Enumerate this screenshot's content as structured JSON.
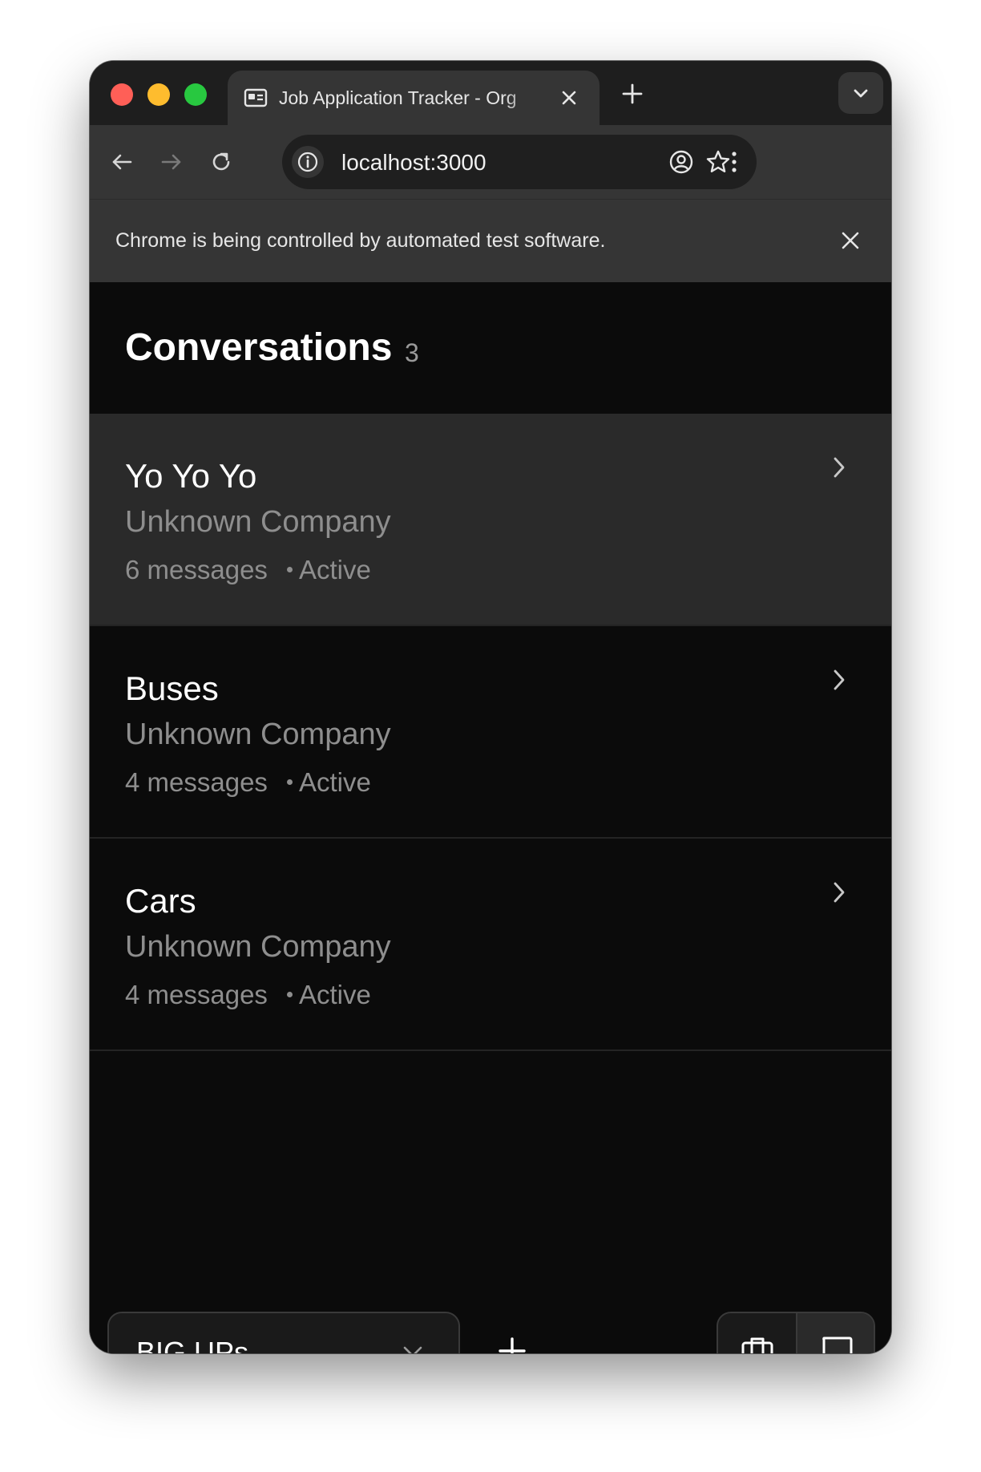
{
  "browser": {
    "tab_title": "Job Application Tracker - Org",
    "url": "localhost:3000",
    "automation_notice": "Chrome is being controlled by automated test software."
  },
  "header": {
    "title": "Conversations",
    "count": "3"
  },
  "conversations": [
    {
      "name": "Yo Yo Yo",
      "company": "Unknown Company",
      "messages": "6 messages",
      "status": "Active",
      "selected": true
    },
    {
      "name": "Buses",
      "company": "Unknown Company",
      "messages": "4 messages",
      "status": "Active",
      "selected": false
    },
    {
      "name": "Cars",
      "company": "Unknown Company",
      "messages": "4 messages",
      "status": "Active",
      "selected": false
    }
  ],
  "footer": {
    "org_select_value": "BIG UPs",
    "active_view": "conversations"
  },
  "icons": {
    "favicon": "id-card-icon",
    "org_chevron": "chevron-down-icon",
    "add": "plus-icon",
    "jobs_view": "briefcase-icon",
    "conversations_view": "chat-bubble-icon"
  },
  "colors": {
    "page_background": "#0b0b0b",
    "selected_row": "#2a2a2a",
    "secondary_text": "#8e8e8e",
    "browser_toolbar": "#353535",
    "tab_strip": "#1e1e1e"
  }
}
